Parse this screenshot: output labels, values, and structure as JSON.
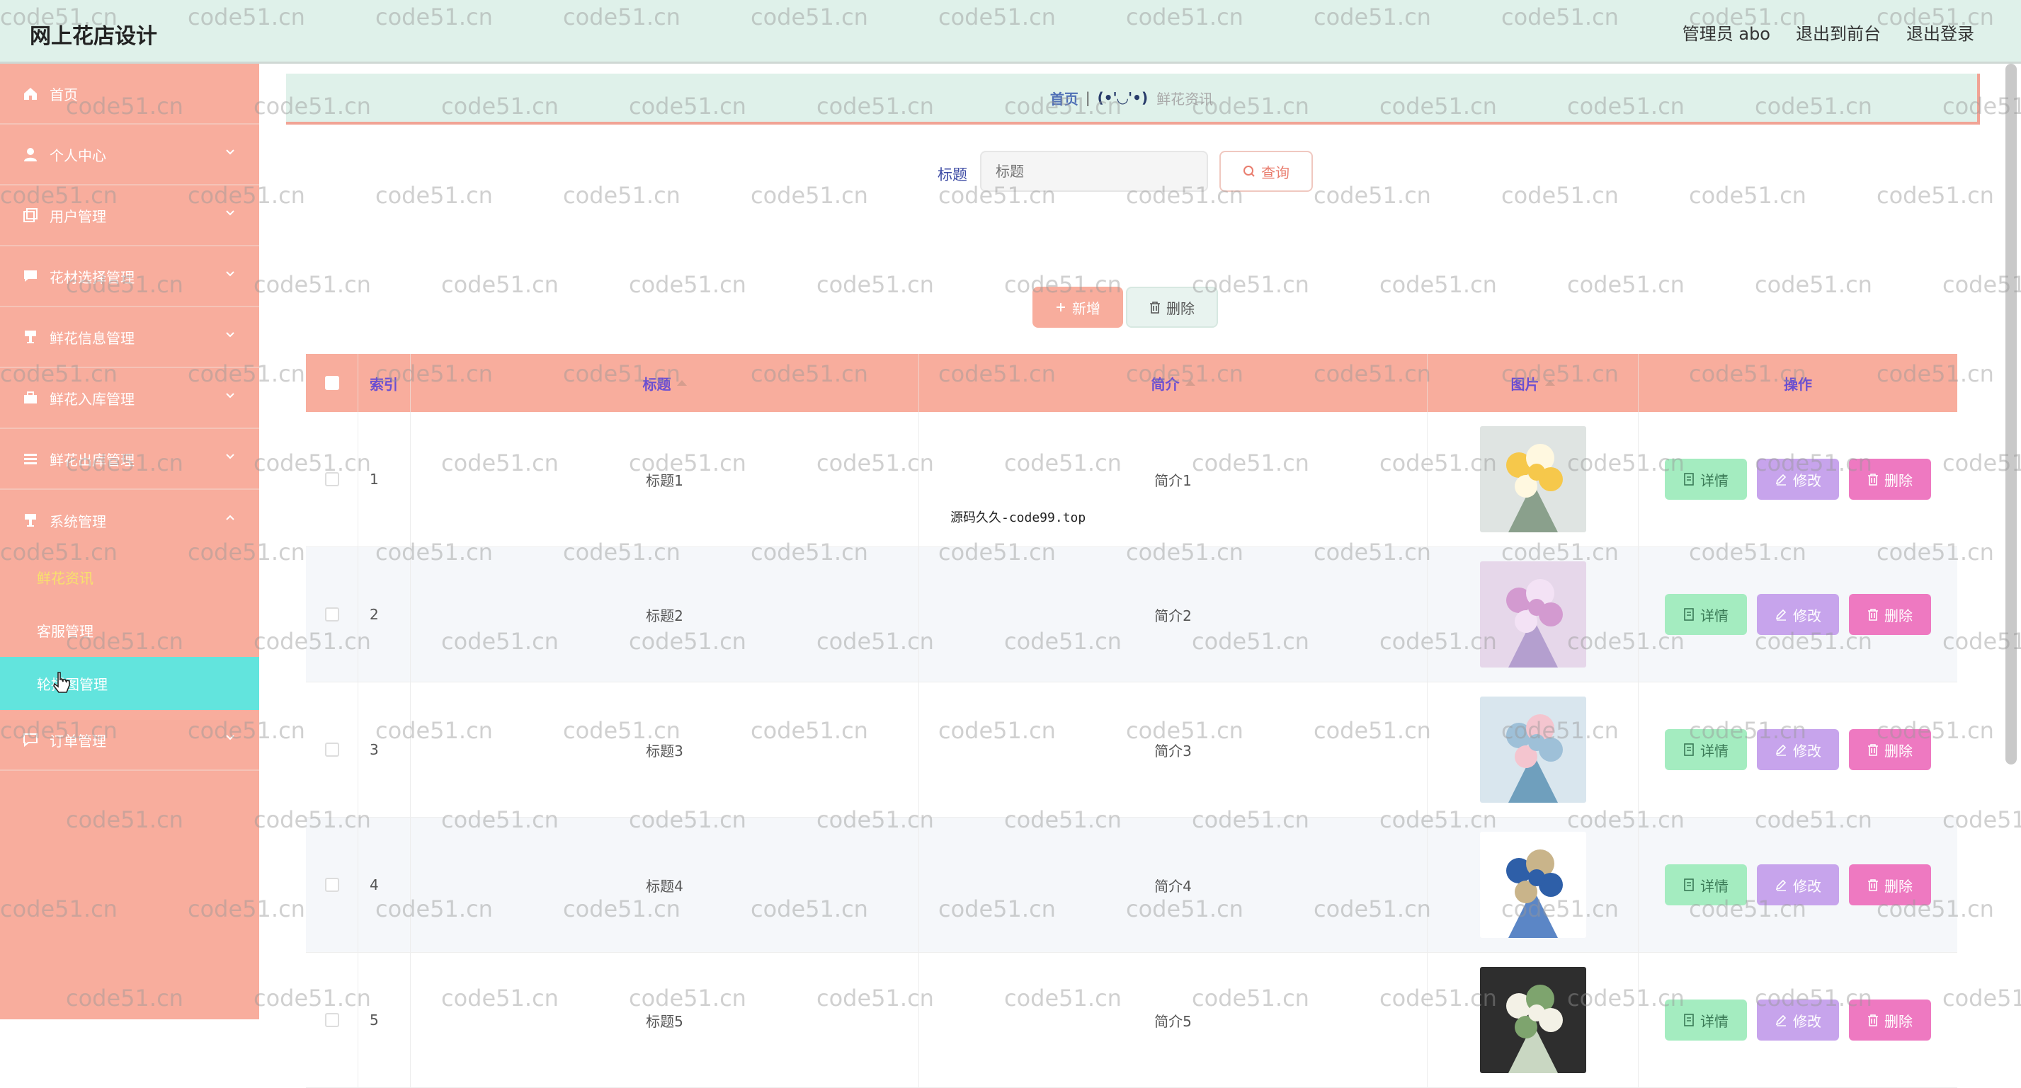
{
  "header": {
    "title": "网上花店设计",
    "user": "管理员 abo",
    "to_front": "退出到前台",
    "logout": "退出登录"
  },
  "sidebar": {
    "items": [
      {
        "label": "首页",
        "icon": "home-icon"
      },
      {
        "label": "个人中心",
        "icon": "person-icon"
      },
      {
        "label": "用户管理",
        "icon": "copy-icon"
      },
      {
        "label": "花材选择管理",
        "icon": "chat-icon"
      },
      {
        "label": "鲜花信息管理",
        "icon": "goblet-icon"
      },
      {
        "label": "鲜花入库管理",
        "icon": "briefcase-icon"
      },
      {
        "label": "鲜花出库管理",
        "icon": "list-icon"
      },
      {
        "label": "系统管理",
        "icon": "goblet-icon"
      }
    ],
    "submenu": [
      {
        "label": "鲜花资讯"
      },
      {
        "label": "客服管理"
      },
      {
        "label": "轮播图管理"
      }
    ],
    "last_item": {
      "label": "订单管理",
      "icon": "chat-icon"
    }
  },
  "breadcrumb": {
    "home": "首页",
    "separator": "|",
    "face": "(•'◡'•)",
    "current": "鲜花资讯"
  },
  "search": {
    "label": "标题",
    "placeholder": "标题",
    "button": "查询"
  },
  "actions": {
    "add": "新增",
    "delete": "删除"
  },
  "table": {
    "columns": [
      "索引",
      "标题",
      "简介",
      "图片",
      "操作"
    ],
    "rows": [
      {
        "index": "1",
        "title": "标题1",
        "intro": "简介1"
      },
      {
        "index": "2",
        "title": "标题2",
        "intro": "简介2"
      },
      {
        "index": "3",
        "title": "标题3",
        "intro": "简介3"
      },
      {
        "index": "4",
        "title": "标题4",
        "intro": "简介4"
      },
      {
        "index": "5",
        "title": "标题5",
        "intro": "简介5"
      }
    ],
    "op_detail": "详情",
    "op_edit": "修改",
    "op_remove": "删除"
  },
  "overlay_text": "源码久久-code99.top",
  "watermark": "code51.cn",
  "colors": {
    "sidebar": "#f8ad9d",
    "header": "#dff1ea",
    "active_sub": "#62e4dd",
    "detail": "#a4ecc0",
    "edit": "#c7a4ec",
    "remove": "#ee79c1"
  }
}
